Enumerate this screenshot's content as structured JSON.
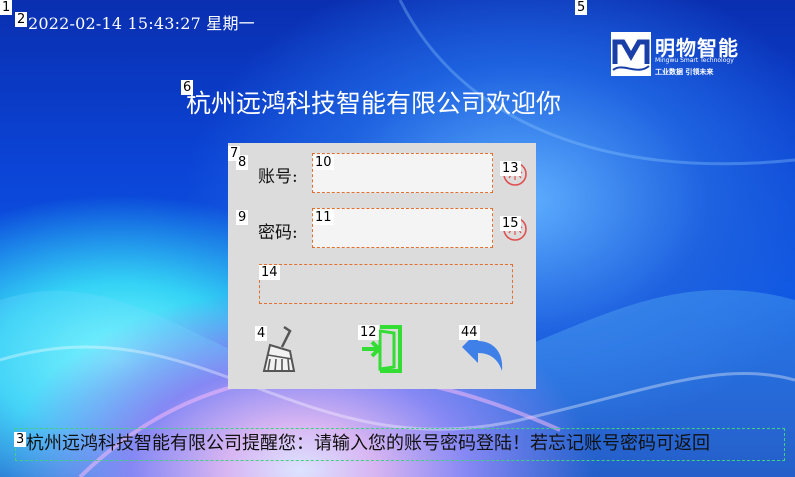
{
  "markers": [
    "1",
    "2",
    "3",
    "4",
    "5",
    "6",
    "7",
    "8",
    "9",
    "10",
    "11",
    "12",
    "13",
    "14",
    "15",
    "44"
  ],
  "header": {
    "datetime": "2022-02-14 15:43:27 星期一"
  },
  "logo": {
    "brand": "明物智能",
    "english": "Mingwu Smart Technology",
    "slogan": "工业数据 引领未来"
  },
  "welcome": "杭州远鸿科技智能有限公司欢迎你",
  "login": {
    "account_label": "账号:",
    "password_label": "密码:",
    "account_value": "",
    "password_value": "",
    "message": ""
  },
  "icons": {
    "clear": "broom-icon",
    "login": "enter-door-icon",
    "back": "back-arrow-icon",
    "show_password": "eye-icon"
  },
  "colors": {
    "dashed_border": "#e07030",
    "login_icon": "#33dd33",
    "back_icon": "#3f7fe8",
    "eye_icon": "#e05050"
  },
  "ticker": "杭州远鸿科技智能有限公司提醒您：请输入您的账号密码登陆！若忘记账号密码可返回"
}
